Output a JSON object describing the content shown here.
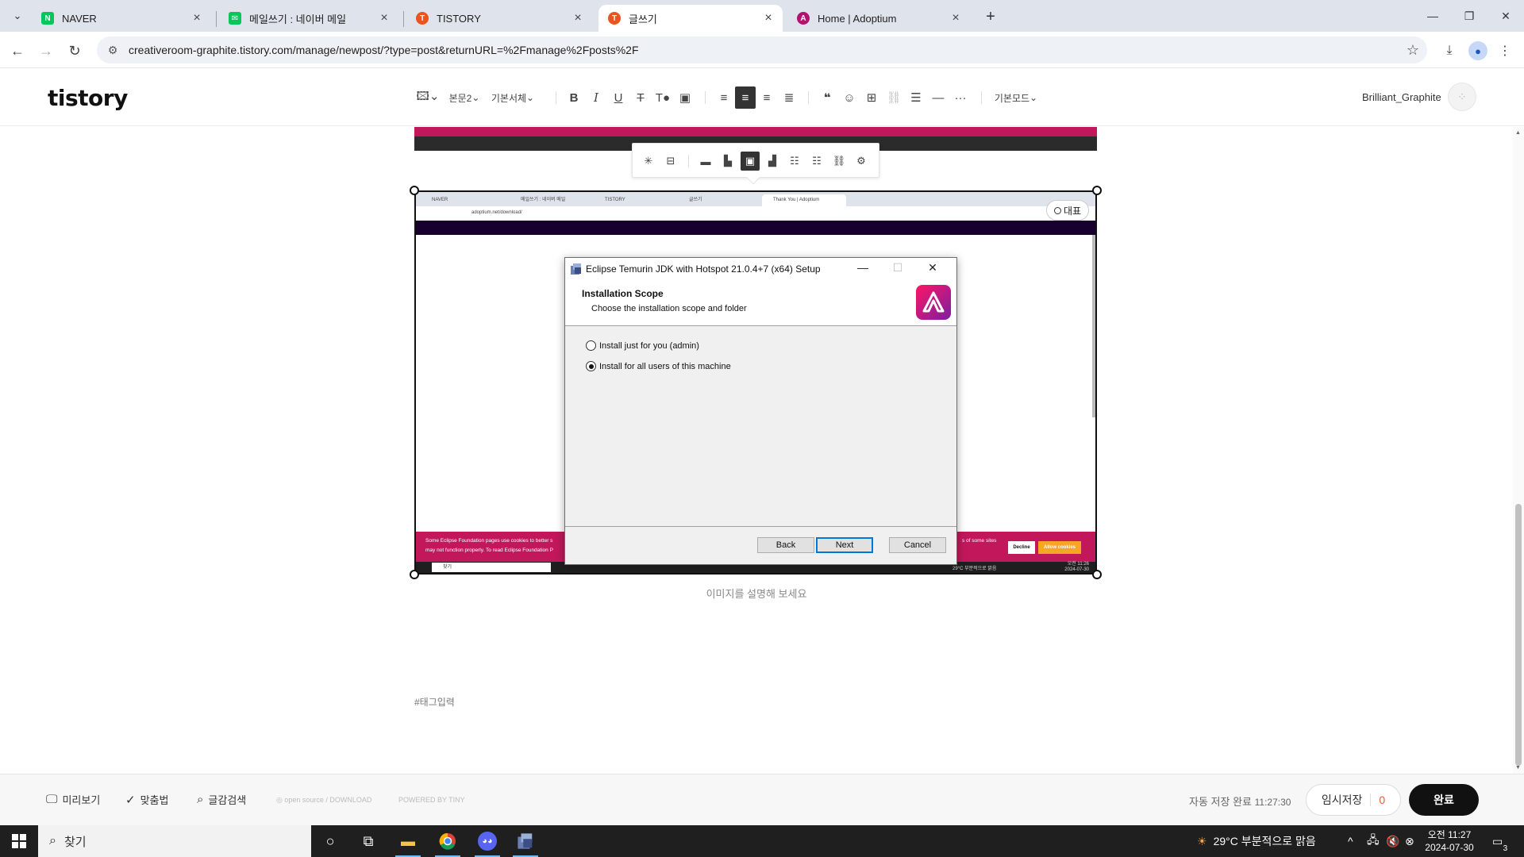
{
  "browser": {
    "tabs": [
      {
        "title": "NAVER",
        "color": "#03c75a",
        "glyph": "N"
      },
      {
        "title": "메일쓰기 : 네이버 메일",
        "color": "#03c75a",
        "glyph": "✉"
      },
      {
        "title": "TISTORY",
        "color": "#eb531f",
        "glyph": "T"
      },
      {
        "title": "글쓰기",
        "color": "#eb531f",
        "glyph": "T"
      },
      {
        "title": "Home | Adoptium",
        "color": "#b5126f",
        "glyph": "A"
      }
    ],
    "active_tab": 3,
    "url": "creativeroom-graphite.tistory.com/manage/newpost/?type=post&returnURL=%2Fmanage%2Fposts%2F"
  },
  "editor": {
    "logo": "tistory",
    "toolbar": {
      "paragraph": "본문2",
      "font": "기본서체",
      "mode": "기본모드"
    },
    "user": "Brilliant_Graphite"
  },
  "image": {
    "rep_label": "대표",
    "caption_placeholder": "이미지를 설명해 보세요",
    "mini_screenshot": {
      "tabs": [
        "NAVER",
        "메일쓰기 : 네이버 메일",
        "TISTORY",
        "글쓰기",
        "Thank You | Adoptium"
      ],
      "url": "adoptium.net/download/",
      "cookie_line1": "Some Eclipse Foundation pages use cookies to better s",
      "cookie_line2": "may not function properly. To read Eclipse Foundation P",
      "cookie_line3": "s of some sites",
      "decline": "Decline",
      "allow": "Allow cookies",
      "search": "찾기",
      "weather": "29°C 부분적으로 맑음",
      "time": "오전 11:26",
      "date": "2024-07-30"
    }
  },
  "dialog": {
    "title": "Eclipse Temurin JDK with Hotspot 21.0.4+7 (x64) Setup",
    "heading": "Installation Scope",
    "subheading": "Choose the installation scope and folder",
    "option_user": "Install just for you (admin)",
    "option_all": "Install for all users of this machine",
    "selected": "all",
    "back": "Back",
    "next": "Next",
    "cancel": "Cancel"
  },
  "tag_placeholder": "#태그입력",
  "footer": {
    "preview": "미리보기",
    "spellcheck": "맞춤법",
    "search_text": "글감검색",
    "opensource": "open source / DOWNLOAD",
    "powered": "POWERED BY TINY",
    "autosave": "자동 저장 완료",
    "autosave_time": "11:27:30",
    "temp_save": "임시저장",
    "temp_count": "0",
    "done": "완료"
  },
  "taskbar": {
    "search": "찾기",
    "weather": "29°C 부분적으로 맑음",
    "time": "오전 11:27",
    "date": "2024-07-30",
    "notifications": "3"
  }
}
